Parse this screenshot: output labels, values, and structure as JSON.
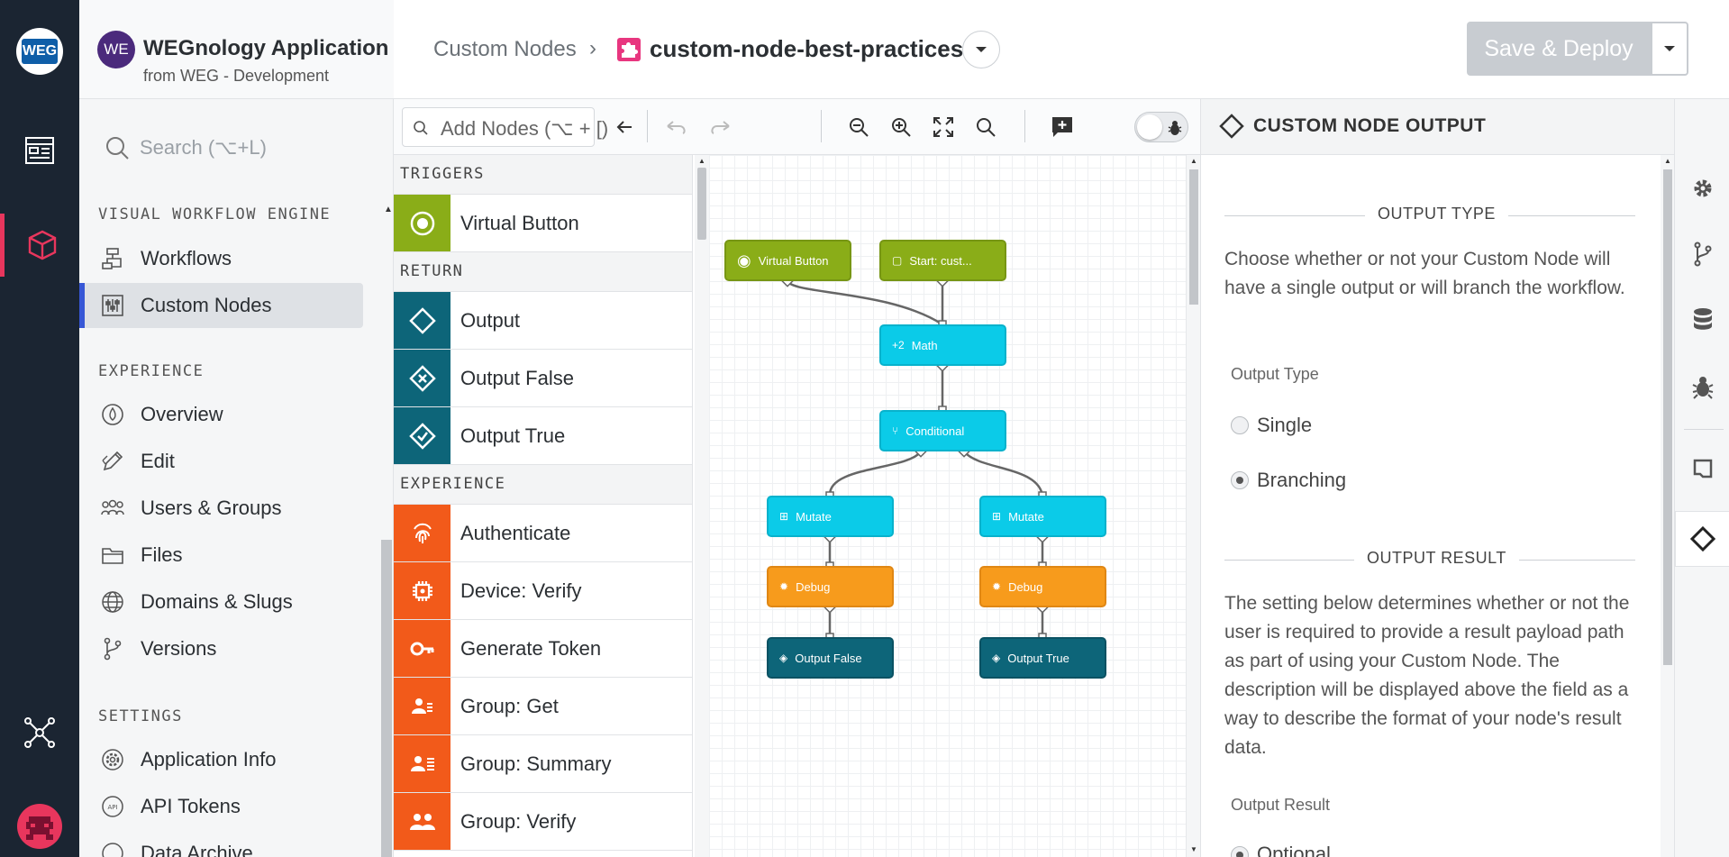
{
  "app": {
    "avatar_text": "WE",
    "name": "WEGnology Application",
    "subtitle": "from WEG - Development",
    "logo_text": "WEG"
  },
  "search": {
    "placeholder": "Search (⌥+L)"
  },
  "nav": {
    "sections": [
      {
        "label": "VISUAL WORKFLOW ENGINE",
        "items": [
          {
            "label": "Workflows",
            "icon": "workflow-icon"
          },
          {
            "label": "Custom Nodes",
            "icon": "custom-nodes-icon",
            "active": true
          }
        ]
      },
      {
        "label": "EXPERIENCE",
        "items": [
          {
            "label": "Overview",
            "icon": "overview-icon"
          },
          {
            "label": "Edit",
            "icon": "edit-icon"
          },
          {
            "label": "Users & Groups",
            "icon": "users-icon"
          },
          {
            "label": "Files",
            "icon": "folder-icon"
          },
          {
            "label": "Domains & Slugs",
            "icon": "globe-icon"
          },
          {
            "label": "Versions",
            "icon": "branch-icon"
          }
        ]
      },
      {
        "label": "SETTINGS",
        "items": [
          {
            "label": "Application Info",
            "icon": "gear-icon"
          },
          {
            "label": "API Tokens",
            "icon": "api-icon"
          },
          {
            "label": "Data Archive",
            "icon": "archive-icon"
          }
        ]
      }
    ]
  },
  "header": {
    "breadcrumb_root": "Custom Nodes",
    "breadcrumb_sep": "›",
    "current": "custom-node-best-practices:...",
    "deploy_label": "Save & Deploy"
  },
  "toolbar": {
    "add_nodes_placeholder": "Add Nodes (⌥ + [)"
  },
  "palette": {
    "sections": [
      {
        "label": "TRIGGERS",
        "items": [
          {
            "label": "Virtual Button",
            "color": "#8aad18",
            "icon": "radio-icon"
          }
        ]
      },
      {
        "label": "RETURN",
        "items": [
          {
            "label": "Output",
            "color": "#0d6579",
            "icon": "output-icon"
          },
          {
            "label": "Output False",
            "color": "#0d6579",
            "icon": "output-false-icon"
          },
          {
            "label": "Output True",
            "color": "#0d6579",
            "icon": "output-true-icon"
          }
        ]
      },
      {
        "label": "EXPERIENCE",
        "items": [
          {
            "label": "Authenticate",
            "color": "#f25a1a",
            "icon": "fingerprint-icon"
          },
          {
            "label": "Device: Verify",
            "color": "#f25a1a",
            "icon": "chip-icon"
          },
          {
            "label": "Generate Token",
            "color": "#f25a1a",
            "icon": "key-icon"
          },
          {
            "label": "Group: Get",
            "color": "#f25a1a",
            "icon": "group-icon"
          },
          {
            "label": "Group: Summary",
            "color": "#f25a1a",
            "icon": "group-summary-icon"
          },
          {
            "label": "Group: Verify",
            "color": "#f25a1a",
            "icon": "group-verify-icon"
          }
        ]
      }
    ]
  },
  "workflow": {
    "nodes": [
      {
        "id": "vb",
        "label": "Virtual Button",
        "color": "green",
        "icon": "◉"
      },
      {
        "id": "start",
        "label": "Start: cust...",
        "color": "green",
        "icon": "▢"
      },
      {
        "id": "math",
        "label": "Math",
        "color": "cyan",
        "icon": "+2"
      },
      {
        "id": "cond",
        "label": "Conditional",
        "color": "cyan",
        "icon": "⑂"
      },
      {
        "id": "mut1",
        "label": "Mutate",
        "color": "cyan",
        "icon": "⊞"
      },
      {
        "id": "mut2",
        "label": "Mutate",
        "color": "cyan",
        "icon": "⊞"
      },
      {
        "id": "dbg1",
        "label": "Debug",
        "color": "orange",
        "icon": "✹"
      },
      {
        "id": "dbg2",
        "label": "Debug",
        "color": "orange",
        "icon": "✹"
      },
      {
        "id": "of",
        "label": "Output False",
        "color": "teal",
        "icon": "◈"
      },
      {
        "id": "ot",
        "label": "Output True",
        "color": "teal",
        "icon": "◈"
      }
    ]
  },
  "panel": {
    "title": "CUSTOM NODE OUTPUT",
    "output_type_heading": "OUTPUT TYPE",
    "output_type_desc": "Choose whether or not your Custom Node will have a single output or will branch the workflow.",
    "output_type_label": "Output Type",
    "options": [
      {
        "label": "Single",
        "checked": false
      },
      {
        "label": "Branching",
        "checked": true
      }
    ],
    "output_result_heading": "OUTPUT RESULT",
    "output_result_desc": "The setting below determines whether or not the user is required to provide a result payload path as part of using your Custom Node. The description will be displayed above the field as a way to describe the format of your node's result data.",
    "output_result_label": "Output Result",
    "output_result_first_option": "Optional"
  }
}
